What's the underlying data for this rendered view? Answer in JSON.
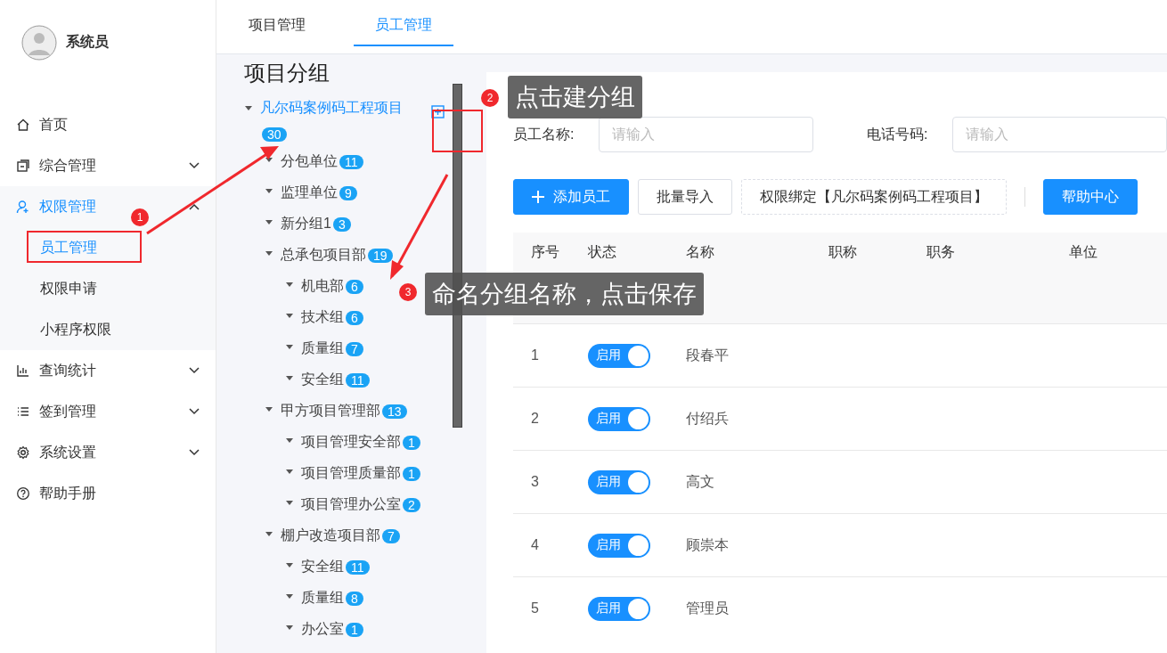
{
  "user": {
    "name": "系统员"
  },
  "menu": [
    {
      "label": "首页",
      "kind": "link",
      "selected": false
    },
    {
      "label": "综合管理",
      "kind": "group",
      "selected": false,
      "expanded": false
    },
    {
      "label": "权限管理",
      "kind": "group",
      "selected": true,
      "expanded": true,
      "children": [
        {
          "label": "员工管理",
          "selected": true
        },
        {
          "label": "权限申请",
          "selected": false
        },
        {
          "label": "小程序权限",
          "selected": false
        }
      ]
    },
    {
      "label": "查询统计",
      "kind": "group",
      "selected": false,
      "expanded": false
    },
    {
      "label": "签到管理",
      "kind": "group",
      "selected": false,
      "expanded": false
    },
    {
      "label": "系统设置",
      "kind": "group",
      "selected": false,
      "expanded": false
    },
    {
      "label": "帮助手册",
      "kind": "link",
      "selected": false
    }
  ],
  "tabs": [
    {
      "label": "项目管理",
      "selected": false
    },
    {
      "label": "员工管理",
      "selected": true
    }
  ],
  "tree": {
    "title": "项目分组",
    "nodes": [
      {
        "label": "凡尔码案例码工程项目",
        "count": "30",
        "selected": true,
        "expanded": true,
        "children": [
          {
            "label": "分包单位",
            "count": "11",
            "selected": false,
            "expanded": true
          },
          {
            "label": "监理单位",
            "count": "9",
            "selected": false,
            "expanded": true
          },
          {
            "label": "新分组1",
            "count": "3",
            "selected": false,
            "expanded": true
          },
          {
            "label": "总承包项目部",
            "count": "19",
            "selected": false,
            "expanded": true,
            "children": [
              {
                "label": "机电部",
                "count": "6",
                "selected": false,
                "expanded": true
              },
              {
                "label": "技术组",
                "count": "6",
                "selected": false,
                "expanded": true
              },
              {
                "label": "质量组",
                "count": "7",
                "selected": false,
                "expanded": true
              },
              {
                "label": "安全组",
                "count": "11",
                "selected": false,
                "expanded": true
              }
            ]
          },
          {
            "label": "甲方项目管理部",
            "count": "13",
            "selected": false,
            "expanded": true,
            "children": [
              {
                "label": "项目管理安全部",
                "count": "1",
                "selected": false,
                "expanded": true
              },
              {
                "label": "项目管理质量部",
                "count": "1",
                "selected": false,
                "expanded": true
              },
              {
                "label": "项目管理办公室",
                "count": "2",
                "selected": false,
                "expanded": true
              }
            ]
          },
          {
            "label": "棚户改造项目部",
            "count": "7",
            "selected": false,
            "expanded": true,
            "children": [
              {
                "label": "安全组",
                "count": "11",
                "selected": false,
                "expanded": true
              },
              {
                "label": "质量组",
                "count": "8",
                "selected": false,
                "expanded": true
              },
              {
                "label": "办公室",
                "count": "1",
                "selected": false,
                "expanded": true
              }
            ]
          }
        ]
      }
    ]
  },
  "search": [
    {
      "label": "员工名称:",
      "placeholder": "请输入"
    },
    {
      "label": "电话号码:",
      "placeholder": "请输入"
    }
  ],
  "toolbar": [
    {
      "label": "添加员工",
      "kind": "add"
    },
    {
      "label": "批量导入",
      "kind": "plain"
    },
    {
      "label": "权限绑定【凡尔码案例码工程项目】",
      "kind": "dashed"
    },
    {
      "label": "帮助中心",
      "kind": "primary"
    }
  ],
  "table": {
    "columns": [
      "序号",
      "状态",
      "名称",
      "职称",
      "职务",
      "单位"
    ],
    "rows": [
      {
        "index": "1",
        "status": "启用",
        "enabled": true,
        "name": "段春平"
      },
      {
        "index": "2",
        "status": "启用",
        "enabled": true,
        "name": "付绍兵"
      },
      {
        "index": "3",
        "status": "启用",
        "enabled": true,
        "name": "高文"
      },
      {
        "index": "4",
        "status": "启用",
        "enabled": true,
        "name": "顾崇本"
      },
      {
        "index": "5",
        "status": "启用",
        "enabled": true,
        "name": "管理员"
      }
    ]
  },
  "annotations": [
    {
      "number": "1"
    },
    {
      "number": "2",
      "text": "点击建分组"
    },
    {
      "number": "3",
      "text": "命名分组名称，点击保存"
    }
  ]
}
